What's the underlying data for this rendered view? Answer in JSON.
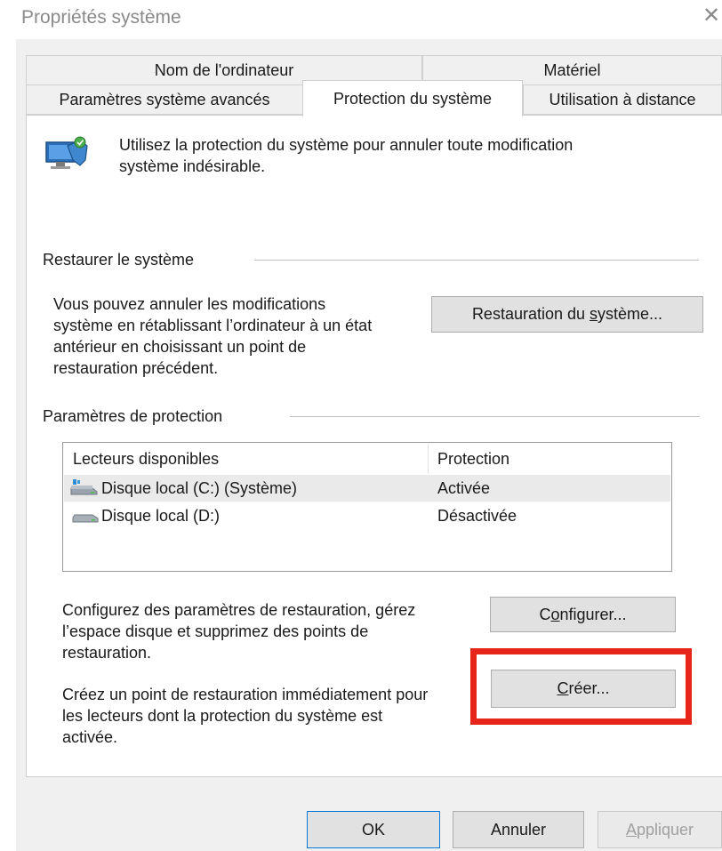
{
  "window": {
    "title": "Propriétés système",
    "close_glyph": "✕"
  },
  "tabs": {
    "computer_name": "Nom de l'ordinateur",
    "hardware": "Matériel",
    "advanced": "Paramètres système avancés",
    "system_protection": "Protection du système",
    "remote": "Utilisation à distance",
    "active": "Protection du système"
  },
  "intro": {
    "icon": "system-protection-shield-icon",
    "text_line1": "Utilisez la protection du système pour annuler toute modification",
    "text_line2": "système indésirable."
  },
  "restore": {
    "group_label": "Restaurer le système",
    "desc_line1": "Vous pouvez annuler les modifications",
    "desc_line2": "système en rétablissant l’ordinateur à un état",
    "desc_line3": "antérieur en choisissant un point de",
    "desc_line4": "restauration précédent.",
    "button_pre": "Restauration du ",
    "button_accel": "s",
    "button_post": "ystème..."
  },
  "protection": {
    "group_label": "Paramètres de protection",
    "columns": [
      "Lecteurs disponibles",
      "Protection"
    ],
    "drives": [
      {
        "name": "Disque local (C:) (Système)",
        "status": "Activée",
        "icon": "system-drive-icon",
        "selected": true
      },
      {
        "name": "Disque local (D:)",
        "status": "Désactivée",
        "icon": "local-drive-icon",
        "selected": false
      }
    ],
    "configure_desc_line1": "Configurez des paramètres de restauration, gérez",
    "configure_desc_line2": "l’espace disque et supprimez des points de",
    "configure_desc_line3": "restauration.",
    "configure_pre": "C",
    "configure_accel": "o",
    "configure_post": "nfigurer...",
    "create_desc_line1": "Créez un point de restauration immédiatement pour",
    "create_desc_line2": "les lecteurs dont la protection du système est",
    "create_desc_line3": "activée.",
    "create_accel": "C",
    "create_post": "réer..."
  },
  "footer": {
    "ok": "OK",
    "cancel": "Annuler",
    "apply_accel": "A",
    "apply_post": "ppliquer"
  },
  "colors": {
    "highlight": "#e8251a",
    "dialog_bg": "#f0f0f0",
    "accent": "#0078d7"
  }
}
